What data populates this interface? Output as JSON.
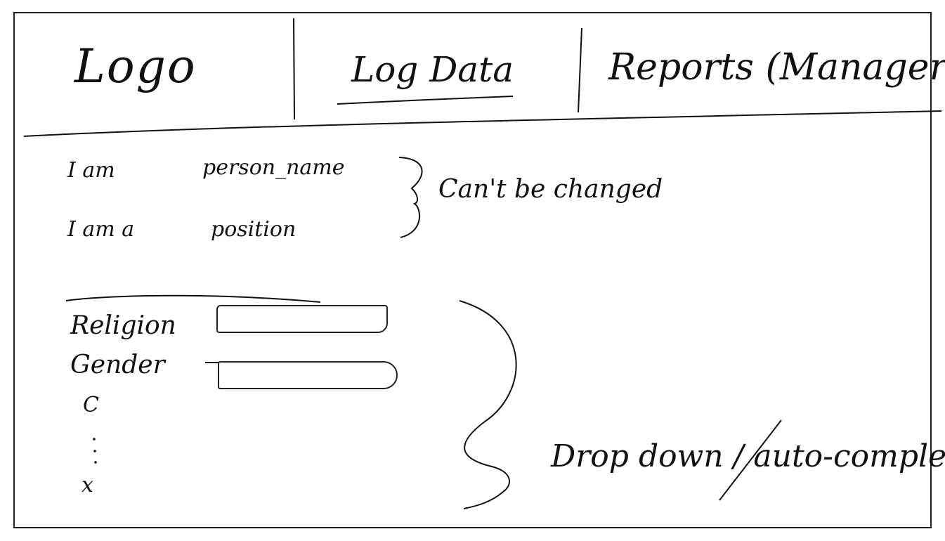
{
  "nav": {
    "logo": "Logo",
    "log_data": "Log Data",
    "reports": "Reports (Manager)"
  },
  "profile": {
    "name_label": "I am",
    "name_value": "person_name",
    "position_label": "I am a",
    "position_value": "position",
    "fixed_note": "Can't be changed"
  },
  "form": {
    "religion_label": "Religion",
    "gender_label": "Gender",
    "c_label": "C",
    "x_label": "x",
    "dropdown_note": "Drop down / auto-complete"
  }
}
